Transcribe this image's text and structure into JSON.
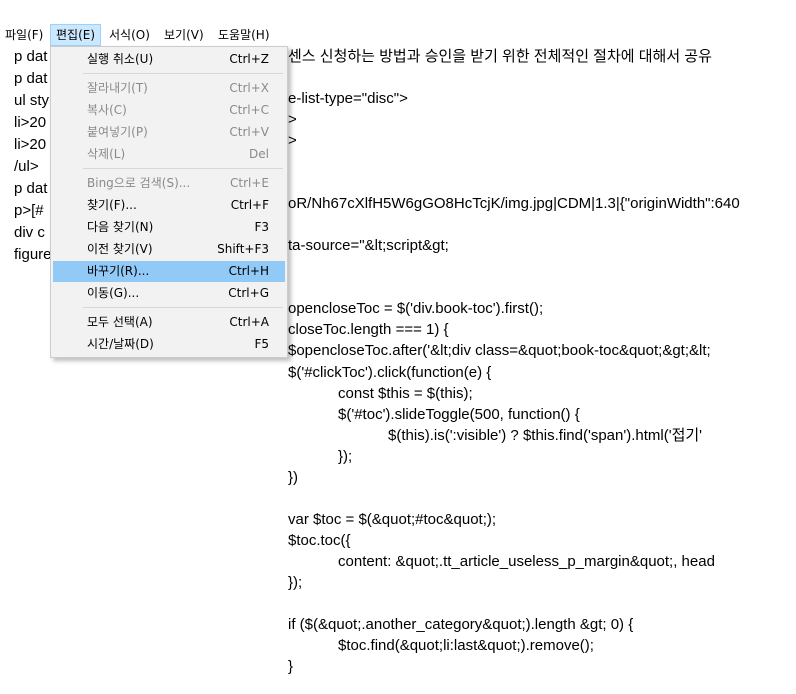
{
  "menubar": {
    "items": [
      {
        "label": "파일(F)"
      },
      {
        "label": "편집(E)"
      },
      {
        "label": "서식(O)"
      },
      {
        "label": "보기(V)"
      },
      {
        "label": "도움말(H)"
      }
    ]
  },
  "edit_menu": {
    "items": [
      {
        "label": "실행 취소(U)",
        "shortcut": "Ctrl+Z",
        "enabled": true
      },
      {
        "label": "잘라내기(T)",
        "shortcut": "Ctrl+X",
        "enabled": false
      },
      {
        "label": "복사(C)",
        "shortcut": "Ctrl+C",
        "enabled": false
      },
      {
        "label": "붙여넣기(P)",
        "shortcut": "Ctrl+V",
        "enabled": false
      },
      {
        "label": "삭제(L)",
        "shortcut": "Del",
        "enabled": false
      },
      {
        "label": "Bing으로 검색(S)...",
        "shortcut": "Ctrl+E",
        "enabled": false
      },
      {
        "label": "찾기(F)...",
        "shortcut": "Ctrl+F",
        "enabled": true
      },
      {
        "label": "다음 찾기(N)",
        "shortcut": "F3",
        "enabled": true
      },
      {
        "label": "이전 찾기(V)",
        "shortcut": "Shift+F3",
        "enabled": true
      },
      {
        "label": "바꾸기(R)...",
        "shortcut": "Ctrl+H",
        "enabled": true,
        "highlighted": true
      },
      {
        "label": "이동(G)...",
        "shortcut": "Ctrl+G",
        "enabled": true
      },
      {
        "label": "모두 선택(A)",
        "shortcut": "Ctrl+A",
        "enabled": true
      },
      {
        "label": "시간/날짜(D)",
        "shortcut": "F5",
        "enabled": true
      }
    ]
  },
  "editor": {
    "left_fragments": [
      "p dat",
      "p dat",
      "ul sty",
      "li>20",
      "li>20",
      "/ul>",
      "p dat",
      "p>[#",
      "div c",
      "figure"
    ],
    "right_lines": [
      "센스 신청하는 방법과 승인을 받기 위한 전체적인 절차에 대해서 공유",
      "",
      "e-list-type=\"disc\">",
      ">",
      ">",
      "",
      "",
      "",
      "oR/Nh67cXlfH5W6gGO8HcTcjK/img.jpg|CDM|1.3|{\"originWidth\":640",
      "",
      "ta-source=\"&lt;script&gt;",
      "",
      "",
      "opencloseToc = $('div.book-toc').first();",
      "closeToc.length === 1) {",
      "$opencloseToc.after('&lt;div class=&quot;book-toc&quot;&gt;&lt;",
      "$('#clickToc').click(function(e) {",
      "            const $this = $(this);",
      "            $('#toc').slideToggle(500, function() {",
      "                        $(this).is(':visible') ? $this.find('span').html('접기'",
      "            });",
      "})",
      "",
      "var $toc = $(&quot;#toc&quot;);",
      "$toc.toc({",
      "            content: &quot;.tt_article_useless_p_margin&quot;, head",
      "});",
      "",
      "if ($(&quot;.another_category&quot;).length &gt; 0) {",
      "            $toc.find(&quot;li:last&quot;).remove();",
      "}"
    ]
  }
}
